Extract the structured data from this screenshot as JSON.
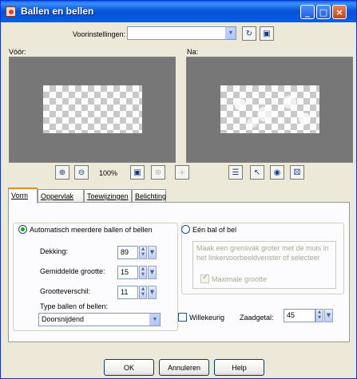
{
  "window": {
    "title": "Ballen en bellen",
    "controls": {
      "minimize": "_",
      "maximize": "□",
      "close": "×"
    }
  },
  "presets": {
    "label": "Voorinstellingen:",
    "value": ""
  },
  "preview": {
    "before_label": "Vóór:",
    "after_label": "Na:",
    "zoom_level": "100%"
  },
  "tabs": [
    {
      "label": "Vorm",
      "active": true
    },
    {
      "label": "Oppervlak",
      "active": false
    },
    {
      "label": "Toewijzingen",
      "active": false
    },
    {
      "label": "Belichting",
      "active": false
    }
  ],
  "vorm": {
    "auto_radio_label": "Automatisch meerdere ballen of bellen",
    "single_radio_label": "Eén bal of bel",
    "single_hint": "Maak een grensvak groter met de muis in het linkervoorbeeldvenster of selecteer",
    "max_size_label": "Maximale grootte",
    "dekking_label": "Dekking:",
    "dekking_value": "89",
    "gem_grootte_label": "Gemiddelde grootte:",
    "gem_grootte_value": "15",
    "grootteverschil_label": "Grootteverschil:",
    "grootteverschil_value": "11",
    "type_label": "Type ballen of bellen:",
    "type_value": "Doorsnijdend",
    "willekeurig_label": "Willekeurig",
    "zaadgetal_label": "Zaadgetal:",
    "zaadgetal_value": "45"
  },
  "buttons": {
    "ok": "OK",
    "cancel": "Annuleren",
    "help": "Help"
  }
}
